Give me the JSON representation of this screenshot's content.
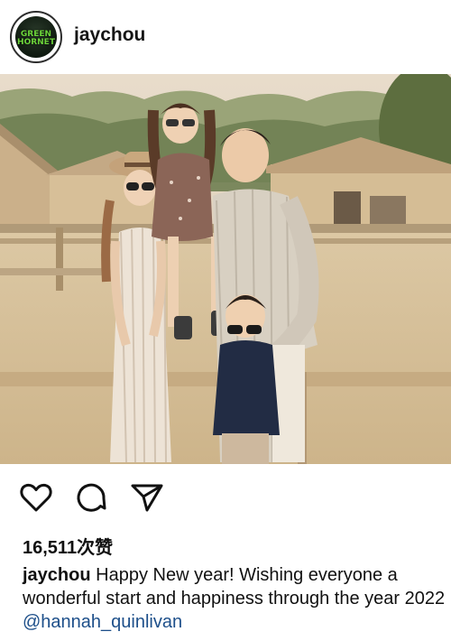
{
  "post": {
    "username": "jaychou",
    "avatar_logo": "GREEN HORNET",
    "likes": "16,511次赞",
    "caption_user": "jaychou",
    "caption_text": "Happy New year! Wishing everyone a wonderful start and happiness through the year 2022",
    "caption_mention": "@hannah_quinlivan"
  },
  "icons": {
    "like": "heart-icon",
    "comment": "comment-icon",
    "share": "send-icon"
  },
  "colors": {
    "mention": "#1d4f8a",
    "text": "#111111"
  }
}
